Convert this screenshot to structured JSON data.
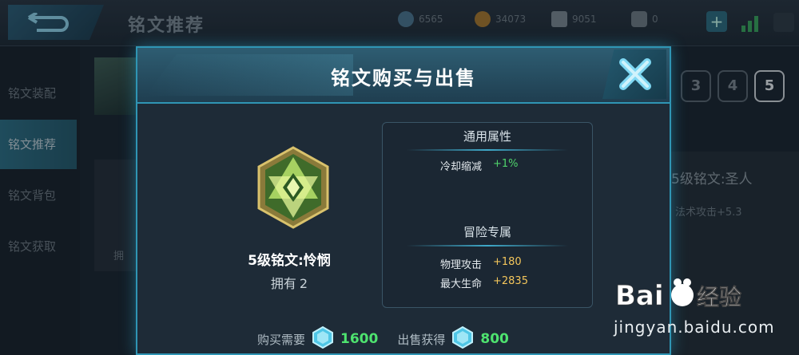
{
  "background": {
    "title": "铭文推荐",
    "currencies": [
      {
        "icon": "diamond-icon",
        "value": "6565",
        "color": "#5f88a3"
      },
      {
        "icon": "gold-coin-icon",
        "value": "34073",
        "color": "#b98b3a"
      },
      {
        "icon": "gem-icon",
        "value": "9051",
        "color": "#8a95a0"
      },
      {
        "icon": "scroll-icon",
        "value": "0",
        "color": "#7e8a93"
      }
    ],
    "sidebar": [
      {
        "label": "铭文装配"
      },
      {
        "label": "铭文推荐",
        "active": true
      },
      {
        "label": "铭文背包"
      },
      {
        "label": "铭文获取"
      }
    ],
    "level_tabs": [
      "3",
      "4",
      "5"
    ],
    "right_panel": {
      "title": "5级铭文:圣人",
      "stat": "法术攻击+5.3"
    },
    "slot_label": "拥"
  },
  "modal": {
    "title": "铭文购买与出售",
    "rune": {
      "name": "5级铭文:怜悯",
      "own_label": "拥有",
      "own_count": "2"
    },
    "sections": [
      {
        "heading": "通用属性",
        "rows": [
          {
            "label": "冷却缩减",
            "value": "+1%"
          }
        ]
      },
      {
        "heading": "冒险专属",
        "rows": [
          {
            "label": "物理攻击",
            "value": "+180"
          },
          {
            "label": "最大生命",
            "value": "+2835"
          }
        ]
      }
    ],
    "footer": {
      "buy_label": "购买需要",
      "buy_price": "1600",
      "sell_label": "出售获得",
      "sell_price": "800"
    }
  },
  "watermark": {
    "brand": "Baidu经验",
    "url": "jingyan.baidu.com"
  },
  "colors": {
    "accent": "#2f95b4",
    "green": "#4fd36b",
    "gold": "#f2c55b"
  }
}
